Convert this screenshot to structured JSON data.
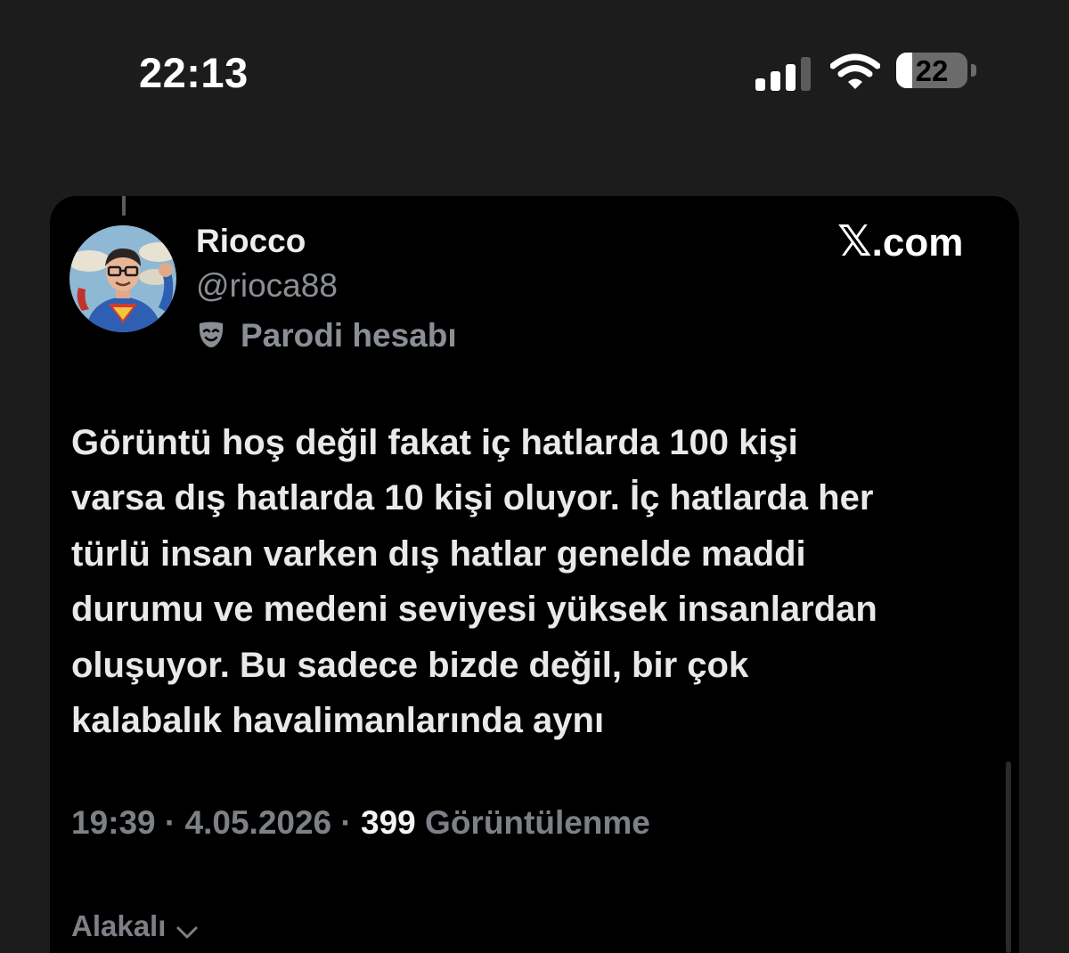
{
  "status_bar": {
    "time": "22:13",
    "battery_percent": "22",
    "battery_level": 0.22,
    "signal_bars_active": 3,
    "signal_bars_total": 4,
    "icons": [
      "cellular-signal-icon",
      "wifi-icon",
      "battery-icon"
    ]
  },
  "post": {
    "author": {
      "display_name": "Riocco",
      "handle": "@rioca88",
      "badge_label": "Parodi hesabı",
      "badge_icon": "parody-mask-icon"
    },
    "source_label": "X.com",
    "text_lines": [
      "Görüntü hoş değil fakat iç hatlarda 100 kişi",
      "varsa dış hatlarda 10 kişi oluyor. İç hatlarda her",
      "türlü insan varken dış hatlar genelde maddi",
      "durumu ve medeni seviyesi yüksek insanlardan",
      "oluşuyor. Bu sadece bizde değil, bir çok",
      "kalabalık havalimanlarında aynı"
    ],
    "meta": {
      "time": "19:39",
      "separator": "·",
      "date": "4.05.2026",
      "views_count": "399",
      "views_label": "Görüntülenme"
    },
    "replies_sort": {
      "label": "Alakalı",
      "icon": "chevron-down-icon"
    }
  },
  "colors": {
    "background": "#1d1c1c",
    "card": "#000000",
    "text_primary": "#e9e9e9",
    "text_secondary": "#7d8186"
  }
}
